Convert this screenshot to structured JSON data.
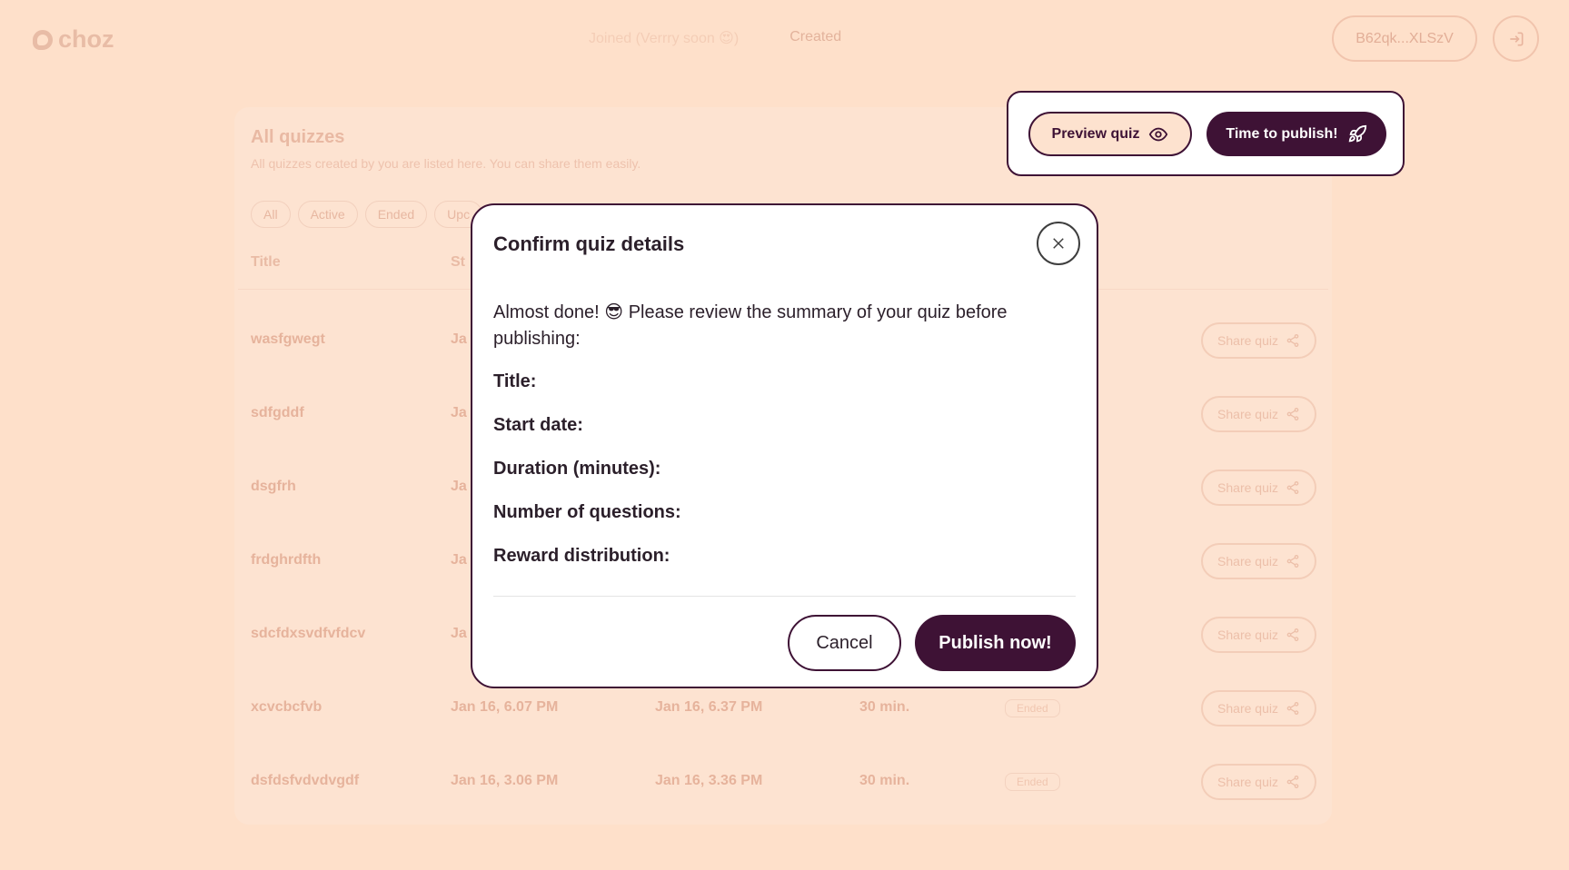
{
  "app": {
    "logo_text": "choz"
  },
  "nav": {
    "joined": "Joined (Verrry soon 😍)",
    "created": "Created"
  },
  "header": {
    "wallet": "B62qk...XLSzV"
  },
  "list": {
    "title": "All quizzes",
    "subtitle": "All quizzes created by you are listed here. You can share them easily.",
    "filters": [
      "All",
      "Active",
      "Ended",
      "Upc"
    ],
    "columns": {
      "title": "Title",
      "start": "St"
    },
    "rows": [
      {
        "title": "wasfgwegt",
        "start": "Ja",
        "end": "",
        "duration": "",
        "status": "",
        "share": "Share quiz"
      },
      {
        "title": "sdfgddf",
        "start": "Ja",
        "end": "",
        "duration": "",
        "status": "",
        "share": "Share quiz"
      },
      {
        "title": "dsgfrh",
        "start": "Ja",
        "end": "",
        "duration": "",
        "status": "",
        "share": "Share quiz"
      },
      {
        "title": "frdghrdfth",
        "start": "Ja",
        "end": "",
        "duration": "",
        "status": "",
        "share": "Share quiz"
      },
      {
        "title": "sdcfdxsvdfvfdcv",
        "start": "Ja",
        "end": "",
        "duration": "",
        "status": "",
        "share": "Share quiz"
      },
      {
        "title": "xcvcbcfvb",
        "start": "Jan 16, 6.07 PM",
        "end": "Jan 16, 6.37 PM",
        "duration": "30 min.",
        "status": "Ended",
        "share": "Share quiz"
      },
      {
        "title": "dsfdsfvdvdvgdf",
        "start": "Jan 16, 3.06 PM",
        "end": "Jan 16, 3.36 PM",
        "duration": "30 min.",
        "status": "Ended",
        "share": "Share quiz"
      }
    ]
  },
  "actions": {
    "preview": "Preview quiz",
    "publish": "Time to publish!"
  },
  "modal": {
    "title": "Confirm quiz details",
    "intro": "Almost done! 😎 Please review the summary of your quiz before publishing:",
    "fields": {
      "title": "Title:",
      "start_date": "Start date:",
      "duration": "Duration (minutes):",
      "questions": "Number of questions:",
      "reward": "Reward distribution:"
    },
    "cancel": "Cancel",
    "publish": "Publish now!"
  }
}
